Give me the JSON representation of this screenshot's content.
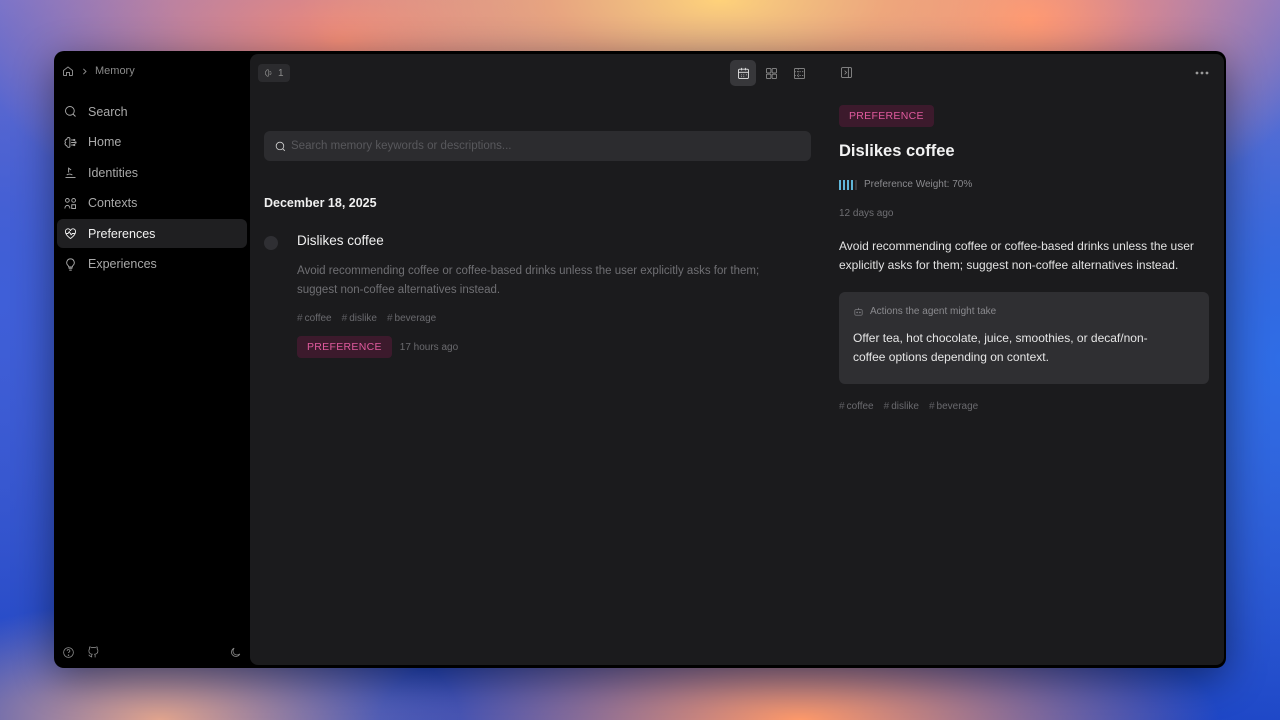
{
  "breadcrumb": {
    "home_icon": "home-icon",
    "separator": "›",
    "current": "Memory"
  },
  "sidebar": {
    "items": [
      {
        "label": "Search",
        "icon": "search-icon",
        "active": false
      },
      {
        "label": "Home",
        "icon": "brain-icon",
        "active": false
      },
      {
        "label": "Identities",
        "icon": "identity-icon",
        "active": false
      },
      {
        "label": "Contexts",
        "icon": "contexts-icon",
        "active": false
      },
      {
        "label": "Preferences",
        "icon": "heart-pulse-icon",
        "active": true
      },
      {
        "label": "Experiences",
        "icon": "lightbulb-icon",
        "active": false
      }
    ],
    "footer_icons": [
      "help-icon",
      "github-icon",
      "moon-icon"
    ]
  },
  "toolbar": {
    "count": "1"
  },
  "search": {
    "placeholder": "Search memory keywords or descriptions..."
  },
  "list": {
    "date_heading": "December 18, 2025",
    "entries": [
      {
        "title": "Dislikes coffee",
        "description": "Avoid recommending coffee or coffee-based drinks unless the user explicitly asks for them; suggest non-coffee alternatives instead.",
        "tags": [
          "coffee",
          "dislike",
          "beverage"
        ],
        "type": "PREFERENCE",
        "time_ago": "17 hours ago"
      }
    ]
  },
  "detail": {
    "type": "PREFERENCE",
    "title": "Dislikes coffee",
    "weight_label": "Preference Weight: 70%",
    "weight_value": 0.7,
    "time_ago": "12 days ago",
    "description": "Avoid recommending coffee or coffee-based drinks unless the user explicitly asks for them; suggest non-coffee alternatives instead.",
    "actions_heading": "Actions the agent might take",
    "actions_body": "Offer tea, hot chocolate, juice, smoothies, or decaf/non-coffee options depending on context.",
    "tags": [
      "coffee",
      "dislike",
      "beverage"
    ]
  },
  "colors": {
    "accent_pink": "#e05a9d",
    "pill_bg": "#3c1a2c",
    "weight_bar": "#60b6d9"
  }
}
